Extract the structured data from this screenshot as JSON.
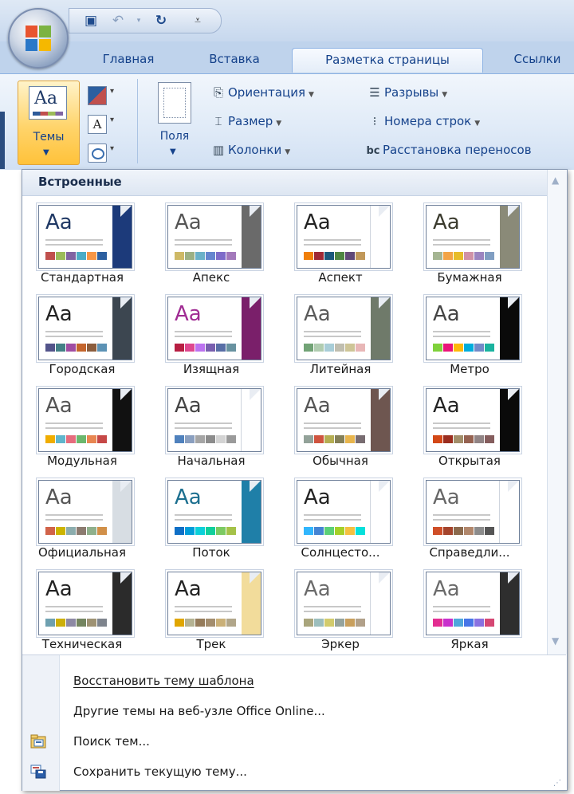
{
  "tabs": [
    "Главная",
    "Вставка",
    "Разметка страницы",
    "Ссылки"
  ],
  "active_tab": "Разметка страницы",
  "ribbon": {
    "themes_label": "Темы",
    "margins_label": "Поля",
    "orientation": "Ориентация",
    "size": "Размер",
    "columns": "Колонки",
    "breaks": "Разрывы",
    "line_numbers": "Номера строк",
    "hyphenation": "Расстановка переносов"
  },
  "gallery": {
    "header": "Встроенные",
    "themes": [
      {
        "name": "Стандартная",
        "aa_color": "#1f3864",
        "side": "#1c3a7a",
        "swatches": [
          "#c0504d",
          "#9bbb59",
          "#8064a2",
          "#4bacc6",
          "#f79646",
          "#2c5fa0"
        ]
      },
      {
        "name": "Апекс",
        "aa_color": "#555555",
        "side": "#6a6a6a",
        "swatches": [
          "#ceb966",
          "#9cb084",
          "#6bb1c9",
          "#6585cf",
          "#7e6bc9",
          "#a379bb"
        ]
      },
      {
        "name": "Аспект",
        "aa_color": "#222222",
        "side": "#ffffff",
        "swatches": [
          "#f07f09",
          "#9f2936",
          "#1b587c",
          "#4e8542",
          "#604878",
          "#c19859"
        ]
      },
      {
        "name": "Бумажная",
        "aa_color": "#3b3b2e",
        "side": "#8a8a78",
        "swatches": [
          "#a5b592",
          "#f3a447",
          "#e7bc29",
          "#d092a7",
          "#9c85c0",
          "#809ec2"
        ]
      },
      {
        "name": "Городская",
        "aa_color": "#222222",
        "side": "#3c4650",
        "swatches": [
          "#53548a",
          "#438086",
          "#a04da3",
          "#c4652d",
          "#8b5d3d",
          "#5c92b5"
        ]
      },
      {
        "name": "Изящная",
        "aa_color": "#a02b93",
        "side": "#7a1f6a",
        "swatches": [
          "#b71e42",
          "#de478e",
          "#bc72f0",
          "#795faf",
          "#586ea6",
          "#6892a0"
        ]
      },
      {
        "name": "Литейная",
        "aa_color": "#5a5a5a",
        "side": "#6f7a6a",
        "swatches": [
          "#72a376",
          "#b0ccb0",
          "#a8cdd7",
          "#c0beaf",
          "#cec597",
          "#e8b7b7"
        ]
      },
      {
        "name": "Метро",
        "aa_color": "#444444",
        "side": "#0a0a0a",
        "swatches": [
          "#7fd13b",
          "#ea157a",
          "#feb80a",
          "#00addc",
          "#738ac8",
          "#1ab39f"
        ]
      },
      {
        "name": "Модульная",
        "aa_color": "#555555",
        "side": "#111111",
        "swatches": [
          "#f0ad00",
          "#60b5cc",
          "#e66c7d",
          "#6bb76d",
          "#e88651",
          "#c64847"
        ]
      },
      {
        "name": "Начальная",
        "aa_color": "#444444",
        "side": "#ffffff",
        "swatches": [
          "#4f81bd",
          "#8a9fbf",
          "#a5a5a5",
          "#8c8c8c",
          "#d3d3d3",
          "#9a9a9a"
        ]
      },
      {
        "name": "Обычная",
        "aa_color": "#555555",
        "side": "#6e5650",
        "swatches": [
          "#93a299",
          "#cf543f",
          "#b5ae53",
          "#848058",
          "#e8b54d",
          "#786c71"
        ]
      },
      {
        "name": "Открытая",
        "aa_color": "#222222",
        "side": "#0a0a0a",
        "swatches": [
          "#d34817",
          "#9b2d1f",
          "#a28e6a",
          "#956251",
          "#918485",
          "#855d5d"
        ]
      },
      {
        "name": "Официальная",
        "aa_color": "#555555",
        "side": "#d7dde3",
        "swatches": [
          "#d16349",
          "#ccb400",
          "#8cadae",
          "#8c7b70",
          "#8fb08c",
          "#d19049"
        ]
      },
      {
        "name": "Поток",
        "aa_color": "#1c6f8f",
        "side": "#1f7fa8",
        "swatches": [
          "#0f6fc6",
          "#009dd9",
          "#0bd0d9",
          "#10cf9b",
          "#7cca62",
          "#a5c249"
        ]
      },
      {
        "name": "Солнцесто...",
        "aa_color": "#222222",
        "side": "#ffffff",
        "swatches": [
          "#31b6fd",
          "#4584d3",
          "#5bd078",
          "#a5d028",
          "#f5c040",
          "#05e0db"
        ]
      },
      {
        "name": "Справедли...",
        "aa_color": "#666666",
        "side": "#ffffff",
        "swatches": [
          "#cf4f28",
          "#a5442c",
          "#8b6a4d",
          "#b1876c",
          "#8c8c8c",
          "#555555"
        ]
      },
      {
        "name": "Техническая",
        "aa_color": "#222222",
        "side": "#2b2b2b",
        "swatches": [
          "#6ea0b0",
          "#ccaf0a",
          "#8d89a4",
          "#748560",
          "#9e9273",
          "#7e848d"
        ]
      },
      {
        "name": "Трек",
        "aa_color": "#222222",
        "side": "#f2dc9b",
        "swatches": [
          "#e0a600",
          "#b4b292",
          "#957b5a",
          "#a38d6e",
          "#cab078",
          "#b1a68a"
        ]
      },
      {
        "name": "Эркер",
        "aa_color": "#6a6a6a",
        "side": "#ffffff",
        "swatches": [
          "#a9a57c",
          "#9cbebd",
          "#d2cb6c",
          "#95a39d",
          "#c89f5d",
          "#b1a089"
        ]
      },
      {
        "name": "Яркая",
        "aa_color": "#6a6a6a",
        "side": "#2e2e2e",
        "swatches": [
          "#e32d91",
          "#c830cc",
          "#4ea6dc",
          "#4775e7",
          "#8971e1",
          "#d54773"
        ]
      }
    ]
  },
  "menu": [
    {
      "label": "Восстановить тему шаблона",
      "icon": "none"
    },
    {
      "label": "Другие темы на веб-узле Office Online...",
      "icon": "none"
    },
    {
      "label": "Поиск тем...",
      "icon": "browse-themes-icon"
    },
    {
      "label": "Сохранить текущую тему...",
      "icon": "save-theme-icon"
    }
  ]
}
